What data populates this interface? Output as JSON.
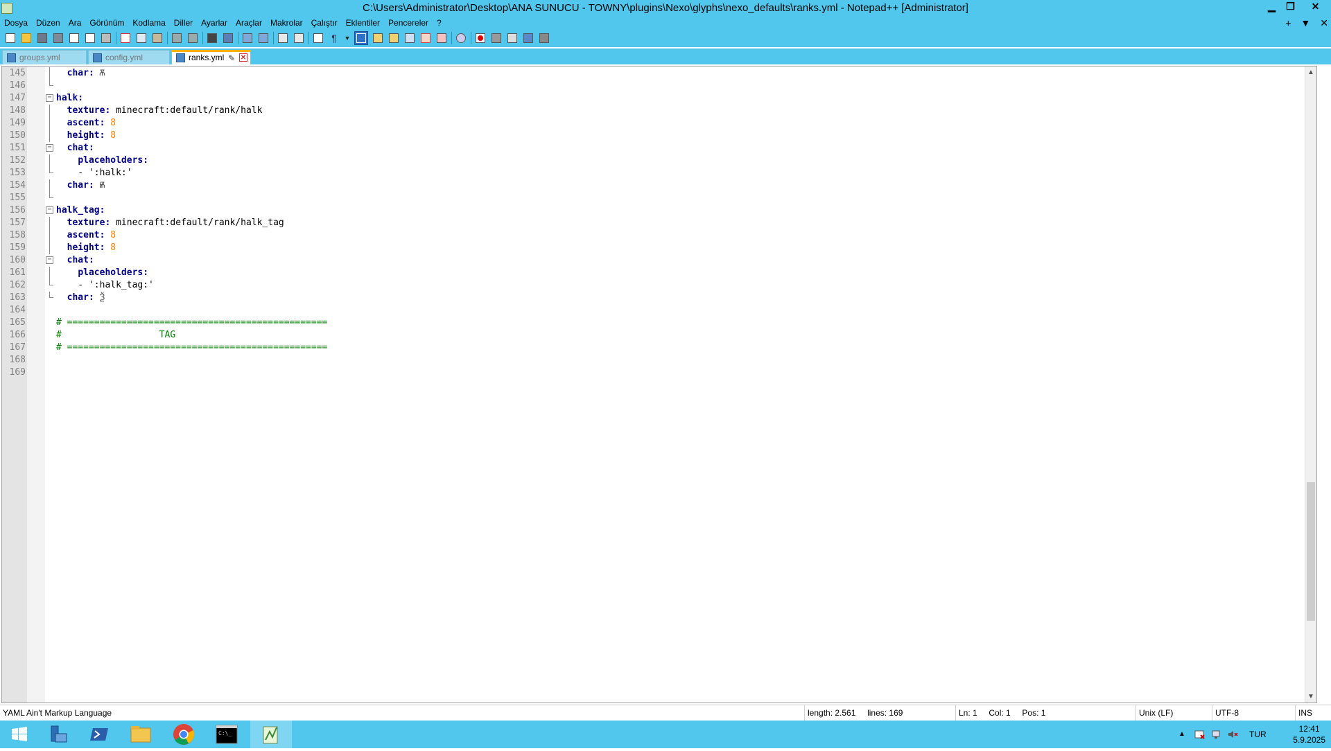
{
  "window": {
    "title": "C:\\Users\\Administrator\\Desktop\\ANA SUNUCU - TOWNY\\plugins\\Nexo\\glyphs\\nexo_defaults\\ranks.yml - Notepad++ [Administrator]",
    "minimize": "▁",
    "restore": "❐",
    "close": "✕"
  },
  "menu": {
    "items": [
      "Dosya",
      "Düzen",
      "Ara",
      "Görünüm",
      "Kodlama",
      "Diller",
      "Ayarlar",
      "Araçlar",
      "Makrolar",
      "Çalıştır",
      "Eklentiler",
      "Pencereler",
      "?"
    ],
    "right": [
      "+",
      "▼",
      "✕"
    ]
  },
  "tabs": [
    {
      "label": "groups.yml",
      "active": false
    },
    {
      "label": "config.yml",
      "active": false
    },
    {
      "label": "ranks.yml",
      "active": true
    }
  ],
  "editor": {
    "lines": [
      {
        "num": "145",
        "text": "  char: ",
        "glyph": "Ѫ",
        "fold": "line"
      },
      {
        "num": "146",
        "text": "",
        "fold": "end"
      },
      {
        "num": "147",
        "key": "halk:",
        "fold": "box"
      },
      {
        "num": "148",
        "text": "  texture: minecraft:default/rank/halk",
        "fold": "line"
      },
      {
        "num": "149",
        "text": "  ascent: 8",
        "fold": "line"
      },
      {
        "num": "150",
        "text": "  height: 8",
        "fold": "line"
      },
      {
        "num": "151",
        "text": "  chat:",
        "fold": "box"
      },
      {
        "num": "152",
        "text": "    placeholders:",
        "fold": "line"
      },
      {
        "num": "153",
        "text": "    - ':halk:'",
        "fold": "end"
      },
      {
        "num": "154",
        "text": "  char: ",
        "glyph": "Ѭ",
        "fold": "line"
      },
      {
        "num": "155",
        "text": "",
        "fold": "end"
      },
      {
        "num": "156",
        "key": "halk_tag:",
        "fold": "box"
      },
      {
        "num": "157",
        "text": "  texture: minecraft:default/rank/halk_tag",
        "fold": "line"
      },
      {
        "num": "158",
        "text": "  ascent: 8",
        "fold": "line"
      },
      {
        "num": "159",
        "text": "  height: 8",
        "fold": "line"
      },
      {
        "num": "160",
        "text": "  chat:",
        "fold": "box"
      },
      {
        "num": "161",
        "text": "    placeholders:",
        "fold": "line"
      },
      {
        "num": "162",
        "text": "    - ':halk_tag:'",
        "fold": "end"
      },
      {
        "num": "163",
        "text": "  char: ",
        "glyph": "Ѯ",
        "fold": "end"
      },
      {
        "num": "164",
        "text": "",
        "fold": ""
      },
      {
        "num": "165",
        "comment": "# ================================================",
        "fold": ""
      },
      {
        "num": "166",
        "comment": "#                  TAG",
        "fold": ""
      },
      {
        "num": "167",
        "comment": "# ================================================",
        "fold": ""
      },
      {
        "num": "168",
        "text": "",
        "fold": ""
      },
      {
        "num": "169",
        "text": "",
        "fold": ""
      }
    ]
  },
  "status": {
    "language": "YAML Ain't Markup Language",
    "length": "length: 2.561",
    "lines": "lines: 169",
    "ln": "Ln: 1",
    "col": "Col: 1",
    "pos": "Pos: 1",
    "eol": "Unix (LF)",
    "encoding": "UTF-8",
    "mode": "INS"
  },
  "taskbar": {
    "lang": "TUR",
    "time": "12:41",
    "date": "5.9.2025"
  },
  "colors": {
    "accent": "#52c7ee",
    "keyword": "#000080",
    "number": "#ff8000",
    "comment": "#008000"
  }
}
